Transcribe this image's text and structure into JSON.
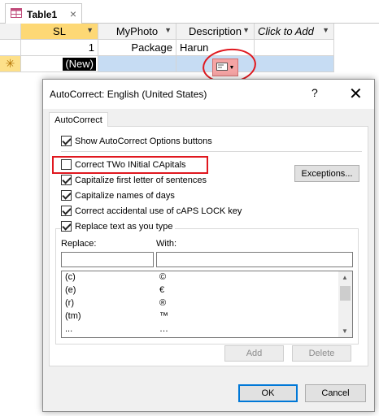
{
  "table": {
    "tab_title": "Table1",
    "tab_close": "×",
    "columns": [
      {
        "label": "SL"
      },
      {
        "label": "MyPhoto"
      },
      {
        "label": "Description"
      },
      {
        "label": "Click to Add"
      }
    ],
    "rows": [
      {
        "sl": "1",
        "photo": "Package",
        "description": "Harun"
      }
    ],
    "new_row_marker": "✳",
    "new_row_label": "(New)"
  },
  "dialog": {
    "title": "AutoCorrect: English (United States)",
    "help": "?",
    "close": "✕",
    "tab": "AutoCorrect",
    "options": [
      {
        "label": "Show AutoCorrect Options buttons",
        "checked": true
      },
      {
        "label": "Correct TWo INitial CApitals",
        "checked": false
      },
      {
        "label": "Capitalize first letter of sentences",
        "checked": true
      },
      {
        "label": "Capitalize names of days",
        "checked": true
      },
      {
        "label": "Correct accidental use of cAPS LOCK key",
        "checked": true
      },
      {
        "label": "Replace text as you type",
        "checked": true
      }
    ],
    "exceptions_button": "Exceptions...",
    "replace_label": "Replace:",
    "with_label": "With:",
    "replace_value": "",
    "with_value": "",
    "entries": [
      {
        "replace": "(c)",
        "with": "©"
      },
      {
        "replace": "(e)",
        "with": "€"
      },
      {
        "replace": "(r)",
        "with": "®"
      },
      {
        "replace": "(tm)",
        "with": "™"
      },
      {
        "replace": "...",
        "with": "…"
      }
    ],
    "add_button": "Add",
    "delete_button": "Delete",
    "ok_button": "OK",
    "cancel_button": "Cancel"
  },
  "colors": {
    "annotation_red": "#e0181f",
    "selected_header": "#fdd875",
    "new_row_fill": "#c6dcf3",
    "default_button_border": "#0078d7"
  }
}
